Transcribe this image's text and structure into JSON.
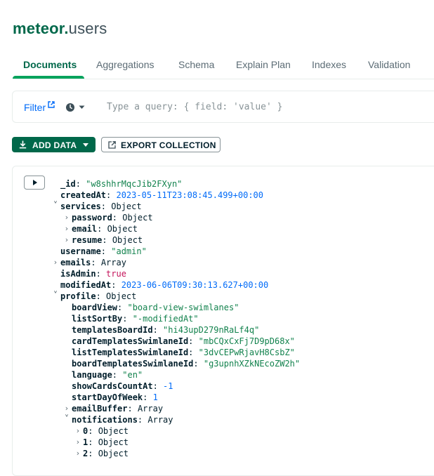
{
  "header": {
    "database": "meteor",
    "separator": ".",
    "collection": "users"
  },
  "tabs": [
    {
      "label": "Documents",
      "active": true
    },
    {
      "label": "Aggregations"
    },
    {
      "label": "Schema"
    },
    {
      "label": "Explain Plan"
    },
    {
      "label": "Indexes"
    },
    {
      "label": "Validation"
    }
  ],
  "filter": {
    "label": "Filter",
    "placeholder": "Type a query: { field: 'value' }",
    "value": ""
  },
  "toolbar": {
    "add_data": "ADD DATA",
    "export": "EXPORT COLLECTION"
  },
  "colors": {
    "accent": "#00684a",
    "link": "#016bf8",
    "string": "#12824d",
    "bool": "#c4135a"
  },
  "document": {
    "fields": [
      {
        "key": "_id",
        "value": "\"w8shhrMqcJib2FXyn\"",
        "vtype": "string",
        "depth": 0
      },
      {
        "key": "createdAt",
        "value": "2023-05-11T23:08:45.499+00:00",
        "vtype": "date",
        "depth": 0
      },
      {
        "key": "services",
        "value": "Object",
        "vtype": "type",
        "depth": 0,
        "chevron": "down"
      },
      {
        "key": "password",
        "value": "Object",
        "vtype": "type",
        "depth": 1,
        "chevron": "right"
      },
      {
        "key": "email",
        "value": "Object",
        "vtype": "type",
        "depth": 1,
        "chevron": "right"
      },
      {
        "key": "resume",
        "value": "Object",
        "vtype": "type",
        "depth": 1,
        "chevron": "right"
      },
      {
        "key": "username",
        "value": "\"admin\"",
        "vtype": "string",
        "depth": 0
      },
      {
        "key": "emails",
        "value": "Array",
        "vtype": "type",
        "depth": 0,
        "chevron": "right"
      },
      {
        "key": "isAdmin",
        "value": "true",
        "vtype": "bool",
        "depth": 0
      },
      {
        "key": "modifiedAt",
        "value": "2023-06-06T09:30:13.627+00:00",
        "vtype": "date",
        "depth": 0
      },
      {
        "key": "profile",
        "value": "Object",
        "vtype": "type",
        "depth": 0,
        "chevron": "down"
      },
      {
        "key": "boardView",
        "value": "\"board-view-swimlanes\"",
        "vtype": "string",
        "depth": 1
      },
      {
        "key": "listSortBy",
        "value": "\"-modifiedAt\"",
        "vtype": "string",
        "depth": 1
      },
      {
        "key": "templatesBoardId",
        "value": "\"hi43upD279nRaLf4q\"",
        "vtype": "string",
        "depth": 1
      },
      {
        "key": "cardTemplatesSwimlaneId",
        "value": "\"mbCQxCxFj7D9pD68x\"",
        "vtype": "string",
        "depth": 1
      },
      {
        "key": "listTemplatesSwimlaneId",
        "value": "\"3dvCEPwRjavH8CsbZ\"",
        "vtype": "string",
        "depth": 1
      },
      {
        "key": "boardTemplatesSwimlaneId",
        "value": "\"g3upnhXZkNEcoZW2h\"",
        "vtype": "string",
        "depth": 1
      },
      {
        "key": "language",
        "value": "\"en\"",
        "vtype": "string",
        "depth": 1
      },
      {
        "key": "showCardsCountAt",
        "value": "-1",
        "vtype": "number",
        "depth": 1
      },
      {
        "key": "startDayOfWeek",
        "value": "1",
        "vtype": "number",
        "depth": 1
      },
      {
        "key": "emailBuffer",
        "value": "Array",
        "vtype": "type",
        "depth": 1,
        "chevron": "right"
      },
      {
        "key": "notifications",
        "value": "Array",
        "vtype": "type",
        "depth": 1,
        "chevron": "down"
      },
      {
        "key": "0",
        "value": "Object",
        "vtype": "type",
        "depth": 2,
        "chevron": "right"
      },
      {
        "key": "1",
        "value": "Object",
        "vtype": "type",
        "depth": 2,
        "chevron": "right"
      },
      {
        "key": "2",
        "value": "Object",
        "vtype": "type",
        "depth": 2,
        "chevron": "right"
      }
    ]
  }
}
